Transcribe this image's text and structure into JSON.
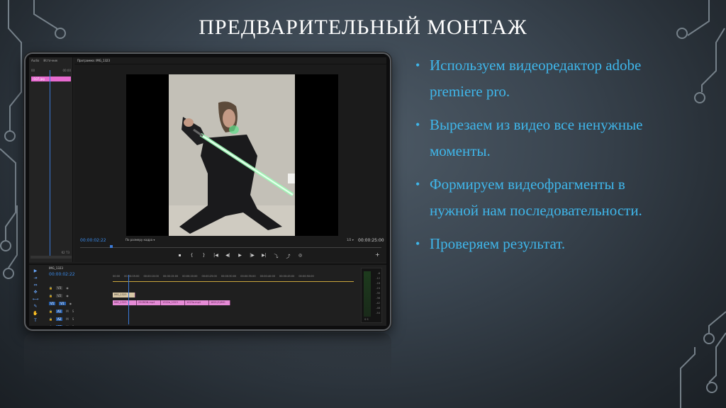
{
  "slide": {
    "title": "ПРЕДВАРИТЕЛЬНЫЙ МОНТАЖ",
    "bullets": [
      "Используем видеоредактор adobe premiere pro.",
      "Вырезаем из видео все ненужные моменты.",
      "Формируем видеофрагменты в нужной нам последовательности.",
      "Проверяем результат."
    ],
    "accent_color": "#3fb6ea"
  },
  "editor": {
    "left_panel": {
      "tabs": [
        "Audio",
        "Источник"
      ],
      "time_start": "00",
      "time_end": "00:00",
      "clip_name": "r107.jpg",
      "footer": "K2 T3"
    },
    "program": {
      "tab_label": "Программа: IMG_1323",
      "timecode_current": "00:00:02:22",
      "fit_label": "По размеру кадра",
      "zoom_label": "1/2",
      "timecode_duration": "00:00:25:00",
      "transport": [
        "▪",
        "{",
        "}",
        "|◀",
        "◀|",
        "▶",
        "|▶",
        "▶|",
        "⤵",
        "⤴",
        "◎"
      ]
    },
    "timeline": {
      "tab_label": "IMG_1323",
      "timecode": "00:00:02:22",
      "tools": [
        "▶",
        "⇥",
        "⇔",
        "✥",
        "⟷",
        "✎",
        "✋",
        "T"
      ],
      "ruler": [
        "00:00",
        "00:00:05:00",
        "00:00:10:00",
        "00:00:15:00",
        "00:00:20:00",
        "00:00:25:00",
        "00:00:30:00",
        "00:00:35:00",
        "00:00:40:00",
        "00:00:45:00",
        "00:00:50:00"
      ],
      "tracks": [
        {
          "name": "V3"
        },
        {
          "name": "V2"
        },
        {
          "name": "V1",
          "active": "V1"
        },
        {
          "name": "A1",
          "active": "A1"
        },
        {
          "name": "A2"
        },
        {
          "name": "A3"
        }
      ],
      "v2_clip": "IMG_1323",
      "v1_clips": [
        "IMG_1323",
        "250RDN.mp4",
        "1322e_1323",
        "1023a.mp4",
        "1821(3)IMG"
      ],
      "meter_labels": [
        "-6",
        "-12",
        "-18",
        "-24",
        "-30",
        "-36",
        "-42",
        "-48",
        "-54"
      ],
      "meter_footer": "S S"
    }
  }
}
